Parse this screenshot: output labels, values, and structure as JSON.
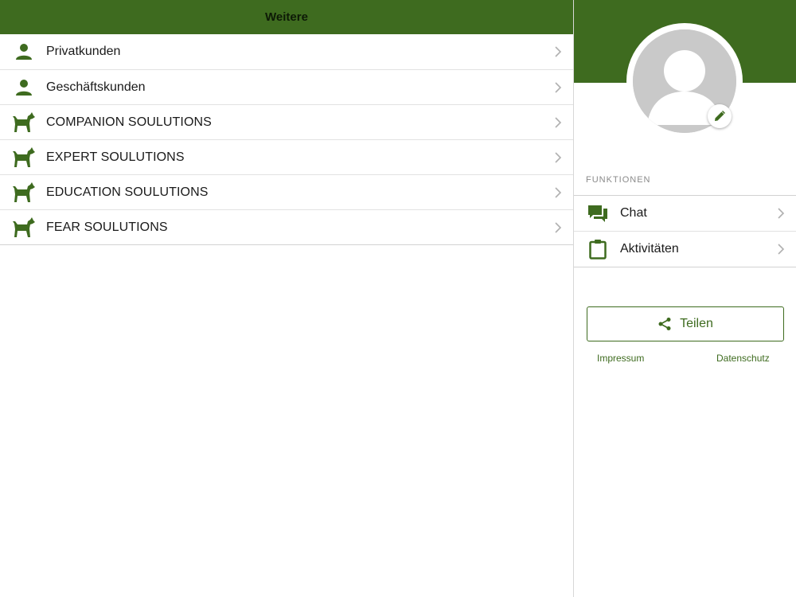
{
  "header": {
    "title": "Weitere"
  },
  "menu": {
    "items": [
      {
        "label": "Privatkunden",
        "icon": "person-icon"
      },
      {
        "label": "Geschäftskunden",
        "icon": "person-icon"
      },
      {
        "label": "COMPANION SOULUTIONS",
        "icon": "dog-icon"
      },
      {
        "label": "EXPERT SOULUTIONS",
        "icon": "dog-icon"
      },
      {
        "label": "EDUCATION SOULUTIONS",
        "icon": "dog-icon"
      },
      {
        "label": "FEAR SOULUTIONS",
        "icon": "dog-icon"
      }
    ]
  },
  "profile": {
    "avatar": "default-avatar",
    "edit_icon": "pencil-icon"
  },
  "functions": {
    "section_title": "FUNKTIONEN",
    "items": [
      {
        "label": "Chat",
        "icon": "chat-icon"
      },
      {
        "label": "Aktivitäten",
        "icon": "clipboard-icon"
      }
    ]
  },
  "share": {
    "label": "Teilen",
    "icon": "share-icon"
  },
  "footer": {
    "impressum": "Impressum",
    "datenschutz": "Datenschutz"
  },
  "colors": {
    "accent": "#3e6b1f",
    "chevron": "#b0b0b0",
    "divider": "#d2d2d2"
  }
}
